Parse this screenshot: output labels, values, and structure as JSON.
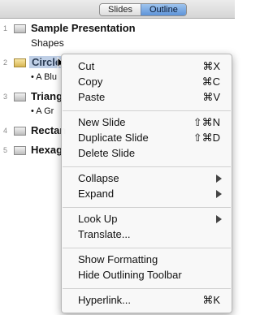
{
  "toolbar": {
    "tabs": [
      "Slides",
      "Outline"
    ],
    "active": "Outline"
  },
  "outline": {
    "rows": [
      {
        "num": "1",
        "title": "Sample Presentation",
        "sub": "Shapes"
      },
      {
        "num": "2",
        "title": "Circle",
        "bullet": "• A Blu"
      },
      {
        "num": "3",
        "title": "Triang",
        "bullet": "• A Gr"
      },
      {
        "num": "4",
        "title": "Rectan"
      },
      {
        "num": "5",
        "title": "Hexag"
      }
    ]
  },
  "menu": {
    "items": [
      {
        "label": "Cut",
        "shortcut": "⌘X"
      },
      {
        "label": "Copy",
        "shortcut": "⌘C"
      },
      {
        "label": "Paste",
        "shortcut": "⌘V"
      },
      {
        "label": "New Slide",
        "shortcut": "⇧⌘N"
      },
      {
        "label": "Duplicate Slide",
        "shortcut": "⇧⌘D"
      },
      {
        "label": "Delete Slide"
      },
      {
        "label": "Collapse",
        "submenu": true
      },
      {
        "label": "Expand",
        "submenu": true
      },
      {
        "label": "Look Up",
        "submenu": true
      },
      {
        "label": "Translate..."
      },
      {
        "label": "Show Formatting"
      },
      {
        "label": "Hide Outlining Toolbar"
      },
      {
        "label": "Hyperlink...",
        "shortcut": "⌘K"
      }
    ]
  }
}
